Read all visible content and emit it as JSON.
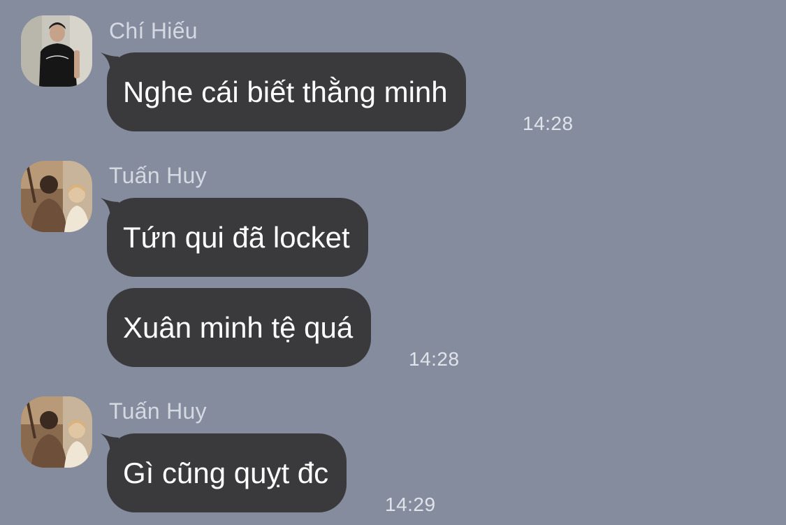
{
  "messages": [
    {
      "sender": "Chí Hiếu",
      "avatar": "person-black-tshirt-avatar",
      "bubbles": [
        "Nghe cái biết thằng minh"
      ],
      "time": "14:28"
    },
    {
      "sender": "Tuấn Huy",
      "avatar": "two-people-warm-tone-avatar",
      "bubbles": [
        "Tứn qui đã locket",
        "Xuân minh tệ quá"
      ],
      "time": "14:28"
    },
    {
      "sender": "Tuấn Huy",
      "avatar": "two-people-warm-tone-avatar",
      "bubbles": [
        "Gì cũng quỵt đc"
      ],
      "time": "14:29"
    }
  ],
  "colors": {
    "background": "#848c9e",
    "bubble": "#3a3a3d",
    "bubble_text": "#ffffff",
    "meta_text": "#d5d9e2"
  }
}
